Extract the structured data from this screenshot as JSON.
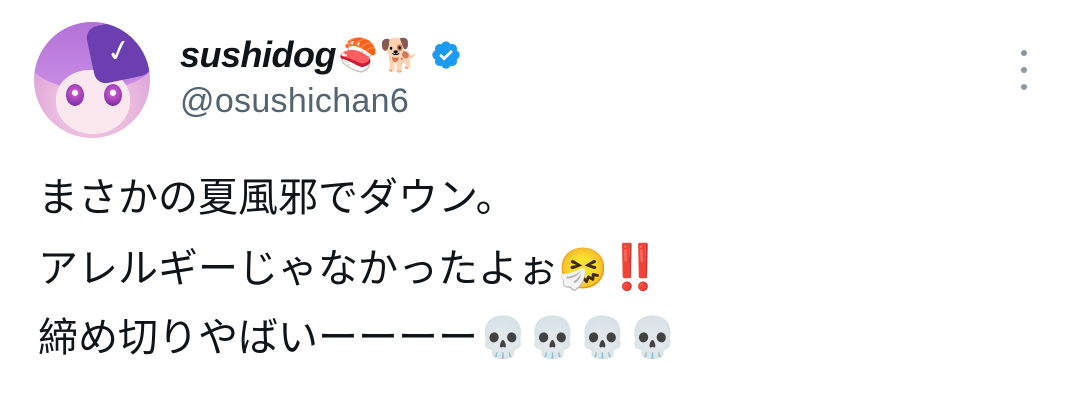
{
  "author": {
    "display_name": "sushidog",
    "name_emojis": [
      "🍣",
      "🐕"
    ],
    "handle": "@osushichan6",
    "verified": true,
    "verified_color": "#1d9bf0",
    "avatar_icon": "avatar-anime-girl"
  },
  "menu": {
    "icon": "more-vertical-icon"
  },
  "tweet": {
    "line1": "まさかの夏風邪でダウン。",
    "line2_text": "アレルギーじゃなかったよぉ",
    "line2_emoji": "🤧",
    "line2_bang": "‼️",
    "line3_text": "締め切りやばいーーーー",
    "line3_emojis": [
      "💀",
      "💀",
      "💀",
      "💀"
    ]
  },
  "colors": {
    "text": "#0f1419",
    "secondary": "#536471",
    "accent": "#1d9bf0",
    "alert": "#d9202a"
  }
}
